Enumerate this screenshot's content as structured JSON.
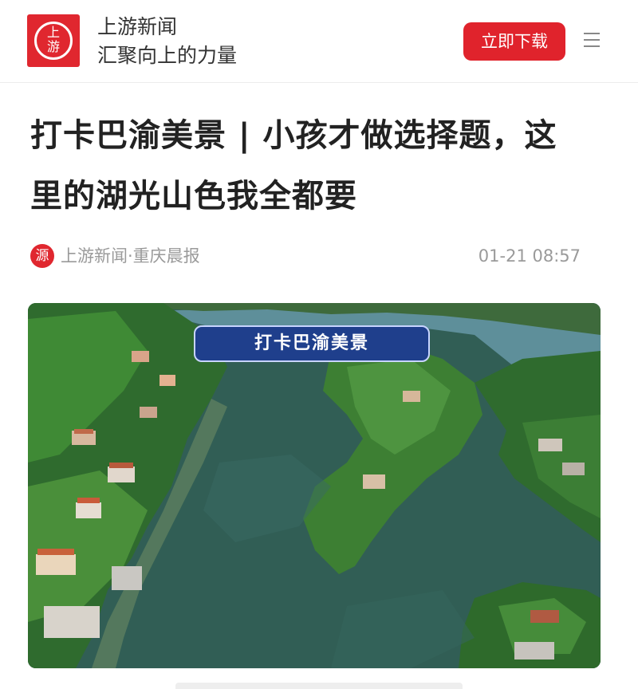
{
  "header": {
    "logo_text": "上\n游",
    "brand_name": "上游新闻",
    "slogan": "汇聚向上的力量",
    "download_label": "立即下载",
    "menu_icon": "hamburger-menu-icon"
  },
  "article": {
    "title": "打卡巴渝美景 | 小孩才做选择题，这里的湖光山色我全都要",
    "source_icon_text": "源",
    "source": "上游新闻·重庆晨报",
    "timestamp": "01-21 08:57",
    "image": {
      "badge_text": "打卡巴渝美景",
      "description_icon": "aerial-lake-photo"
    }
  },
  "colors": {
    "brand_red": "#e0272f",
    "badge_blue": "#1f3f8c",
    "meta_gray": "#9a9a9a"
  }
}
